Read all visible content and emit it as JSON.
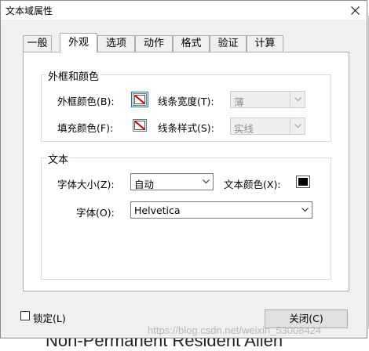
{
  "window": {
    "title": "文本域属性"
  },
  "tabs": [
    {
      "label": "一般"
    },
    {
      "label": "外观"
    },
    {
      "label": "选项"
    },
    {
      "label": "动作"
    },
    {
      "label": "格式"
    },
    {
      "label": "验证"
    },
    {
      "label": "计算"
    }
  ],
  "active_tab": "外观",
  "border_group": {
    "title": "外框和颜色",
    "border_color_label": "外框颜色(B):",
    "fill_color_label": "填充颜色(F):",
    "line_width_label": "线条宽度(T):",
    "line_width_value": "薄",
    "line_style_label": "线条样式(S):",
    "line_style_value": "实线"
  },
  "text_group": {
    "title": "文本",
    "font_size_label": "字体大小(Z):",
    "font_size_value": "自动",
    "text_color_label": "文本颜色(X):",
    "font_label": "字体(O):",
    "font_value": "Helvetica"
  },
  "footer": {
    "lock_label": "锁定(L)",
    "lock_checked": false,
    "close_button": "关闭(C)"
  },
  "background": {
    "document_text": "Non-Permanent Resident Alien",
    "watermark": "https://blog.csdn.net/weixin_53008424"
  },
  "colors": {
    "text_color_swatch": "#000000",
    "no_color_slash": "#cc0000",
    "focus": "#0078d7"
  }
}
